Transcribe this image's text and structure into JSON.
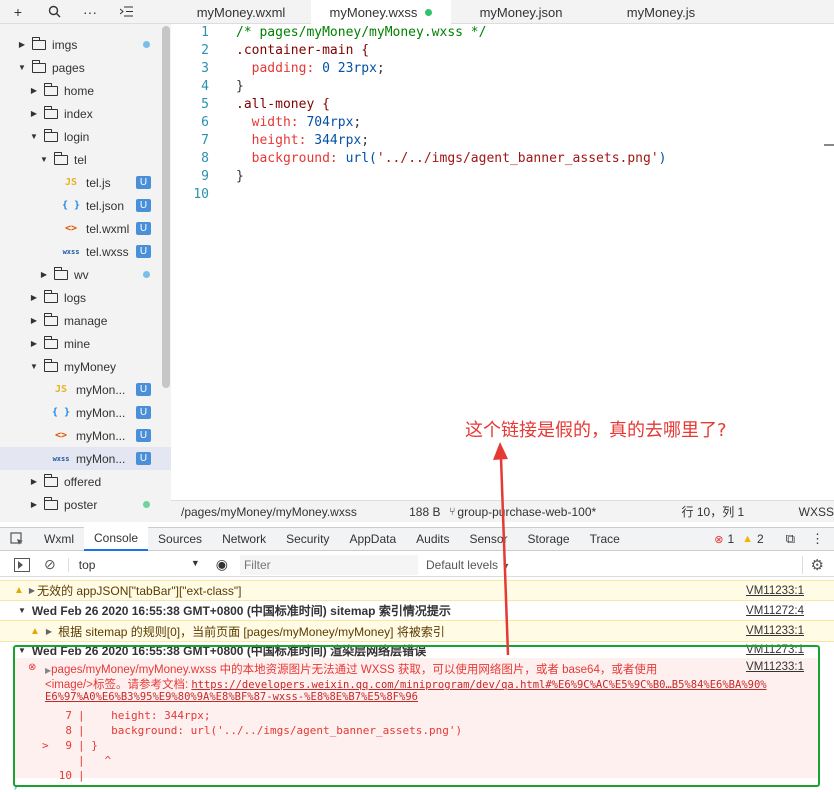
{
  "toolbar": {
    "icons": [
      "plus-icon",
      "search-icon",
      "more-icon",
      "collapse-icon"
    ]
  },
  "tabs": [
    {
      "label": "myMoney.wxml"
    },
    {
      "label": "myMoney.wxss"
    },
    {
      "label": "myMoney.json"
    },
    {
      "label": "myMoney.js"
    }
  ],
  "tree": [
    {
      "label": "imgs"
    },
    {
      "label": "pages"
    },
    {
      "label": "home"
    },
    {
      "label": "index"
    },
    {
      "label": "login"
    },
    {
      "label": "tel"
    },
    {
      "label": "tel.js",
      "icon": "JS",
      "badge": "U"
    },
    {
      "label": "tel.json",
      "icon": "{ }",
      "badge": "U"
    },
    {
      "label": "tel.wxml",
      "icon": "<>",
      "badge": "U"
    },
    {
      "label": "tel.wxss",
      "icon": "wxss",
      "badge": "U"
    },
    {
      "label": "wv"
    },
    {
      "label": "logs"
    },
    {
      "label": "manage"
    },
    {
      "label": "mine"
    },
    {
      "label": "myMoney"
    },
    {
      "label": "myMon...",
      "icon": "JS",
      "badge": "U"
    },
    {
      "label": "myMon...",
      "icon": "{ }",
      "badge": "U"
    },
    {
      "label": "myMon...",
      "icon": "<>",
      "badge": "U"
    },
    {
      "label": "myMon...",
      "icon": "wxss",
      "badge": "U"
    },
    {
      "label": "offered"
    },
    {
      "label": "poster"
    }
  ],
  "code": {
    "line_numbers": [
      "1",
      "2",
      "3",
      "4",
      "5",
      "6",
      "7",
      "8",
      "9",
      "10"
    ],
    "l1": "/* pages/myMoney/myMoney.wxss */",
    "l2": ".container-main {",
    "l3_prop": "padding:",
    "l3_val": "0 23rpx",
    "l4": "}",
    "l5": ".all-money {",
    "l6_prop": "width:",
    "l6_val": "704rpx",
    "l7_prop": "height:",
    "l7_val": "344rpx",
    "l8_prop": "background:",
    "l8_fn": "url(",
    "l8_str": "'../../imgs/agent_banner_assets.png'",
    "l8_close": ")",
    "l9": "}",
    "semicolon": ";"
  },
  "status": {
    "path": "/pages/myMoney/myMoney.wxss",
    "size": "188 B",
    "branch": "group-purchase-web-100*",
    "position": "行 10，列 1",
    "lang": "WXSS"
  },
  "annotation": "这个链接是假的，真的去哪里了?",
  "devtools": {
    "tabs": [
      "Wxml",
      "Console",
      "Sources",
      "Network",
      "Security",
      "AppData",
      "Audits",
      "Sensor",
      "Storage",
      "Trace"
    ],
    "errors": "1",
    "warnings": "2",
    "context": "top",
    "filter_placeholder": "Filter",
    "levels": "Default levels"
  },
  "console": {
    "m1_text": "无效的 appJSON[\"tabBar\"][\"ext-class\"]",
    "m1_vm": "VM11233:1",
    "m2_text": "Wed Feb 26 2020 16:55:38 GMT+0800 (中国标准时间) sitemap 索引情况提示",
    "m2_vm": "VM11272:4",
    "m3_text": "根据 sitemap 的规则[0]，当前页面 [pages/myMoney/myMoney] 将被索引",
    "m3_vm": "VM11233:1",
    "m4_text": "Wed Feb 26 2020 16:55:38 GMT+0800 (中国标准时间) 渲染层网络层错误",
    "m4_vm": "VM11273:1",
    "err_line1": "pages/myMoney/myMoney.wxss 中的本地资源图片无法通过 WXSS 获取，可以使用网络图片，或者 base64，或者使用",
    "err_line2_a": "<image/>标签。请参考文档: ",
    "err_link_1": "https://developers.weixin.qq.com/miniprogram/dev/qa.html#%E6%9C%AC%E5%9C%B0…B5%84%E6%BA%90%",
    "err_link_2": "E6%97%A0%E6%B3%95%E9%80%9A%E8%BF%87-wxss-%E8%8E%B7%E5%8F%96",
    "err_vm": "VM11233:1",
    "snip": [
      {
        "mark": "",
        "num": "7",
        "code": "|    height: 344rpx;"
      },
      {
        "mark": "",
        "num": "8",
        "code": "|    background: url('../../imgs/agent_banner_assets.png')"
      },
      {
        "mark": ">",
        "num": "9",
        "code": "| }"
      },
      {
        "mark": "",
        "num": "",
        "code": "|   ^"
      },
      {
        "mark": "",
        "num": "10",
        "code": "|"
      }
    ]
  },
  "colors": {
    "error_bg": "#fff0f0",
    "warn_bg": "#fffbe5",
    "box": "#19a32e",
    "annot": "#e53935"
  }
}
